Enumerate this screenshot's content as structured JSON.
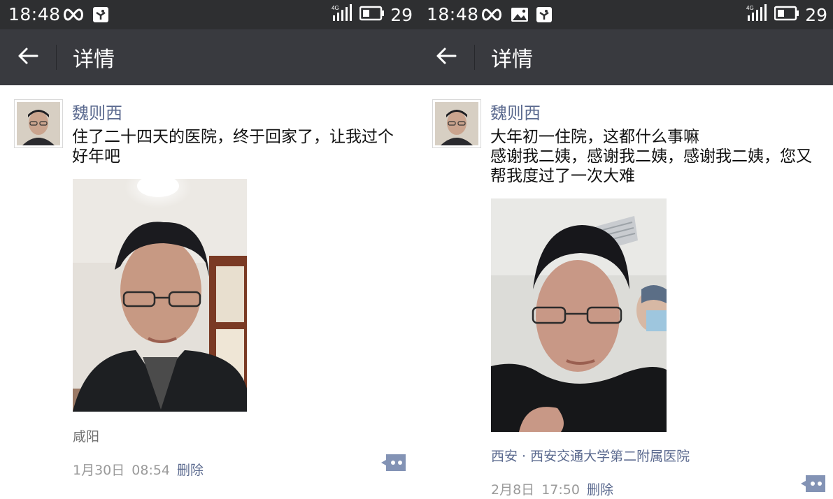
{
  "screens": [
    {
      "status": {
        "time": "18:48",
        "battery": "29"
      },
      "appbar": {
        "title": "详情"
      },
      "post": {
        "username": "魏则西",
        "text_lines": [
          "住了二十四天的医院，终于回家了，让我过个",
          "好年吧"
        ],
        "location": "咸阳",
        "date": "1月30日",
        "time": "08:54",
        "delete_label": "删除"
      }
    },
    {
      "status": {
        "time": "18:48",
        "battery": "29"
      },
      "appbar": {
        "title": "详情"
      },
      "post": {
        "username": "魏则西",
        "text_lines": [
          "大年初一住院，这都什么事嘛",
          "感谢我二姨，感谢我二姨，感谢我二姨，您又",
          "帮我度过了一次大难"
        ],
        "location": "西安 · 西安交通大学第二附属医院",
        "date": "2月8日",
        "time": "17:50",
        "delete_label": "删除"
      }
    }
  ],
  "icons": {
    "status_left_1": "infinity-icon",
    "status_left_2": "app-notification-icon",
    "status_left_3": "image-notification-icon",
    "signal": "4g-signal-icon",
    "battery": "battery-icon",
    "back": "arrow-left-icon",
    "comment": "comment-bubble-icon"
  },
  "colors": {
    "statusbar": "#2e2f31",
    "appbar": "#393a3f",
    "link": "#5b6a8f",
    "meta": "#9a9a9a",
    "comment_button": "#8393b5"
  }
}
